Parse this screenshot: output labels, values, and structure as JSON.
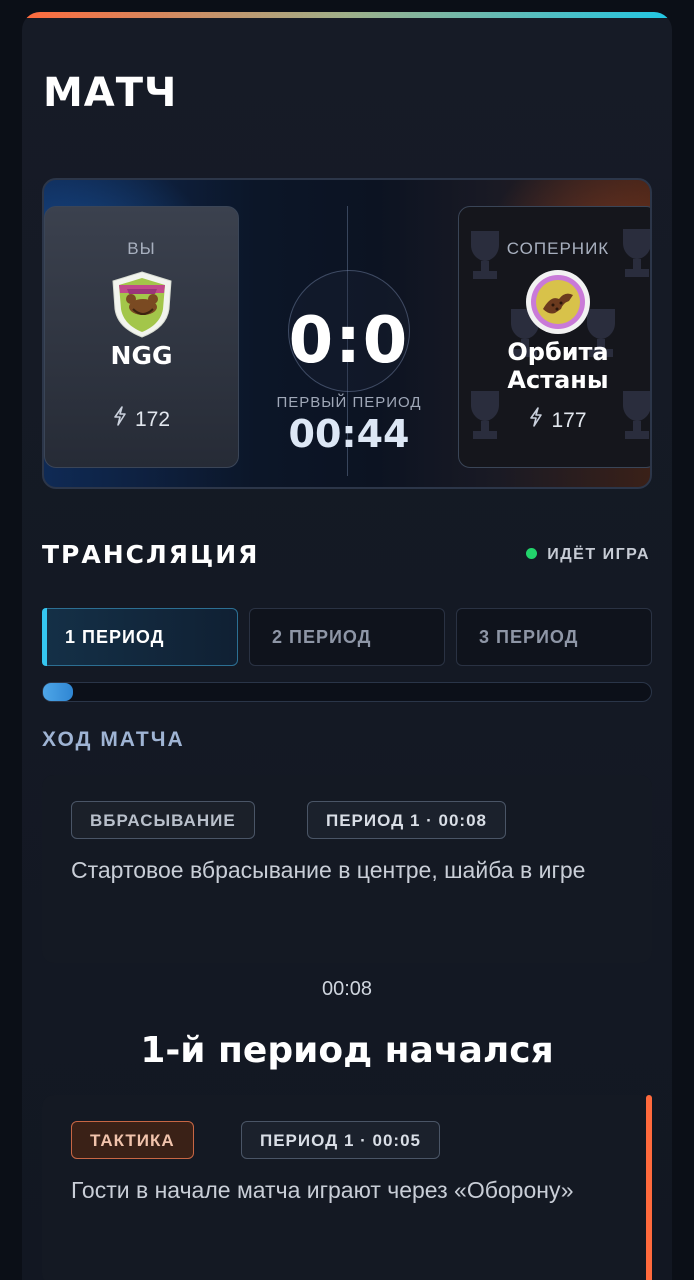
{
  "page": {
    "title": "МАТЧ"
  },
  "match": {
    "home": {
      "role": "ВЫ",
      "name": "NGG",
      "rating": "172",
      "logo_icon": "ngg-shield-logo-icon"
    },
    "away": {
      "role": "СОПЕРНИК",
      "name_line1": "Орбита",
      "name_line2": "Астаны",
      "rating": "177",
      "logo_icon": "orbita-astana-logo-icon"
    },
    "score": "0:0",
    "period_name": "ПЕРВЫЙ ПЕРИОД",
    "clock": "00:44"
  },
  "broadcast": {
    "title": "ТРАНСЛЯЦИЯ",
    "status": "ИДЁТ ИГРА",
    "status_color": "#22d46b",
    "tabs": [
      {
        "label": "1 ПЕРИОД",
        "active": true
      },
      {
        "label": "2 ПЕРИОД",
        "active": false
      },
      {
        "label": "3 ПЕРИОД",
        "active": false
      }
    ],
    "progress_fraction": 0.05
  },
  "feed": {
    "title": "ХОД МАТЧА",
    "events": [
      {
        "type": "ВБРАСЫВАНИЕ",
        "time": "ПЕРИОД 1 · 00:08",
        "text": "Стартовое вбрасывание в центре, шайба в игре"
      },
      {
        "type": "ТАКТИКА",
        "time": "ПЕРИОД 1 · 00:05",
        "text": "Гости в начале матча играют через «Оборону»"
      }
    ],
    "separator": {
      "time": "00:08",
      "label": "1-й период начался"
    }
  },
  "colors": {
    "accent_orange": "#ff6a3d",
    "accent_cyan": "#21c7e4"
  }
}
